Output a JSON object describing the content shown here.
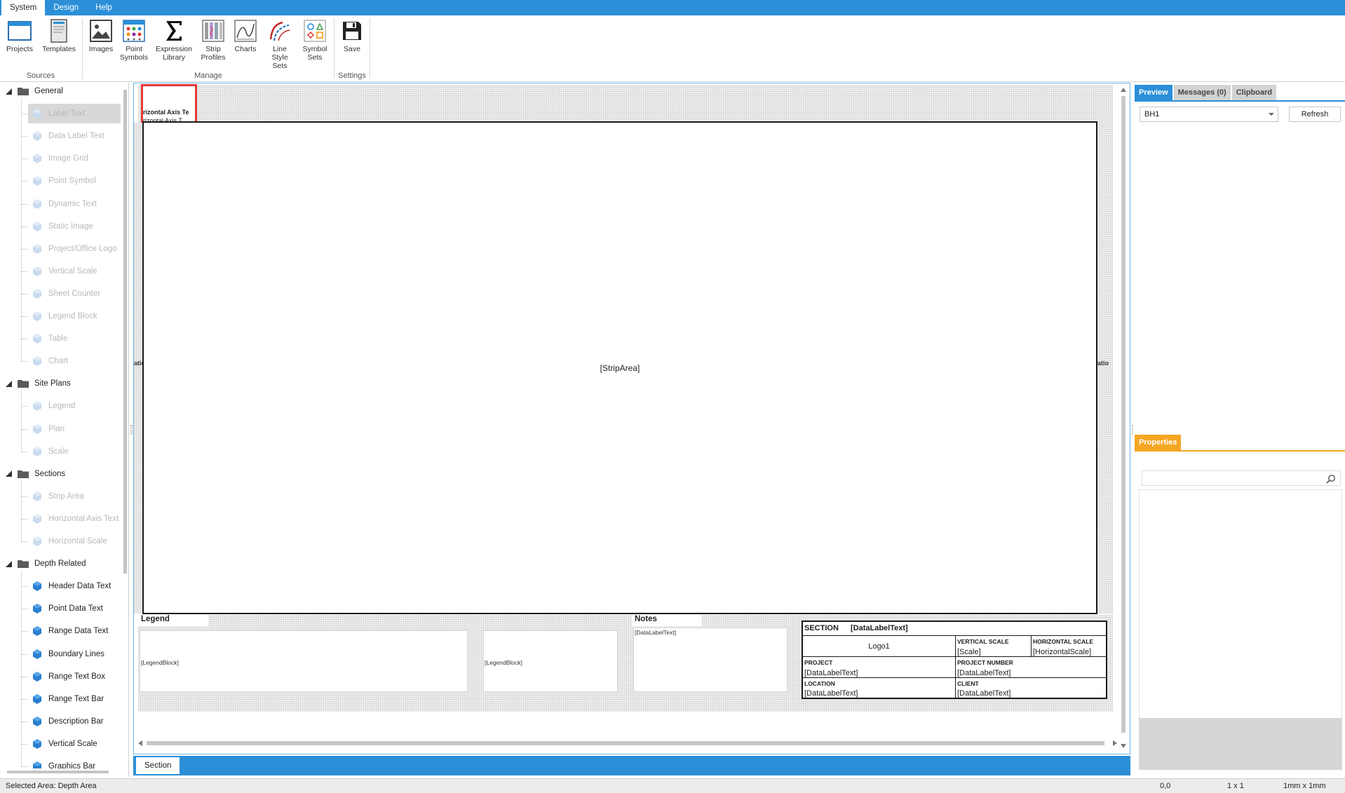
{
  "menu": {
    "tabs": [
      "System",
      "Design",
      "Help"
    ],
    "active": "System"
  },
  "ribbon": {
    "groups": {
      "sources": "Sources",
      "manage": "Manage",
      "settings": "Settings"
    },
    "buttons": {
      "projects": "Projects",
      "templates": "Templates",
      "images": "Images",
      "point_symbols": "Point\nSymbols",
      "expression_library": "Expression\nLibrary",
      "strip_profiles": "Strip\nProfiles",
      "charts": "Charts",
      "line_style_sets": "Line\nStyle Sets",
      "symbol_sets": "Symbol\nSets",
      "save": "Save"
    }
  },
  "tree": {
    "general": {
      "label": "General",
      "items": [
        "Label Text",
        "Data Label Text",
        "Image Grid",
        "Point Symbol",
        "Dynamic Text",
        "Static Image",
        "Project/Office Logo",
        "Vertical Scale",
        "Sheet Counter",
        "Legend Block",
        "Table",
        "Chart"
      ]
    },
    "site_plans": {
      "label": "Site Plans",
      "items": [
        "Legend",
        "Plan",
        "Scale"
      ]
    },
    "sections": {
      "label": "Sections",
      "items": [
        "Strip Area",
        "Horizontal Axis Text",
        "Horizontal Scale"
      ]
    },
    "depth_related": {
      "label": "Depth Related",
      "items": [
        "Header Data Text",
        "Point Data Text",
        "Range Data Text",
        "Boundary Lines",
        "Range Text Box",
        "Range Text Bar",
        "Description Bar",
        "Vertical Scale",
        "Graphics Bar"
      ]
    },
    "selected_item": "Label Text"
  },
  "designer": {
    "axis_text_line1": "rizontal Axis Te",
    "axis_text_line2": "rizontal Axis T",
    "strip_area": "[StripArea]",
    "left_edge_text": "atio",
    "right_edge_text": "atio",
    "legend_header": "Legend",
    "legend_block_1": "[LegendBlock]",
    "legend_block_2": "[LegendBlock]",
    "notes_header": "Notes",
    "notes_value": "[DataLabelText]",
    "title_block": {
      "section_label": "SECTION",
      "section_value": "[DataLabelText]",
      "logo": "Logo1",
      "vertical_scale_label": "VERTICAL SCALE",
      "vertical_scale_value": "[Scale]",
      "horizontal_scale_label": "HORIZONTAL SCALE",
      "horizontal_scale_value": "[HorizontalScale]",
      "project_label": "PROJECT",
      "project_value": "[DataLabelText]",
      "project_number_label": "PROJECT NUMBER",
      "project_number_value": "[DataLabelText]",
      "location_label": "LOCATION",
      "location_value": "[DataLabelText]",
      "client_label": "CLIENT",
      "client_value": "[DataLabelText]"
    },
    "bottom_tab": "Section"
  },
  "right_panel": {
    "tabs": [
      "Preview",
      "Messages (0)",
      "Clipboard"
    ],
    "active_tab": "Preview",
    "borehole_select": "BH1",
    "refresh_label": "Refresh",
    "properties_tab": "Properties",
    "search_placeholder": ""
  },
  "status": {
    "selected_area": "Selected Area: Depth Area",
    "coords": "0,0",
    "grid": "1 x 1",
    "units": "1mm x 1mm"
  },
  "colors": {
    "accent": "#2b8fd8",
    "properties_accent": "#f5a623",
    "selection": "#e53935"
  }
}
